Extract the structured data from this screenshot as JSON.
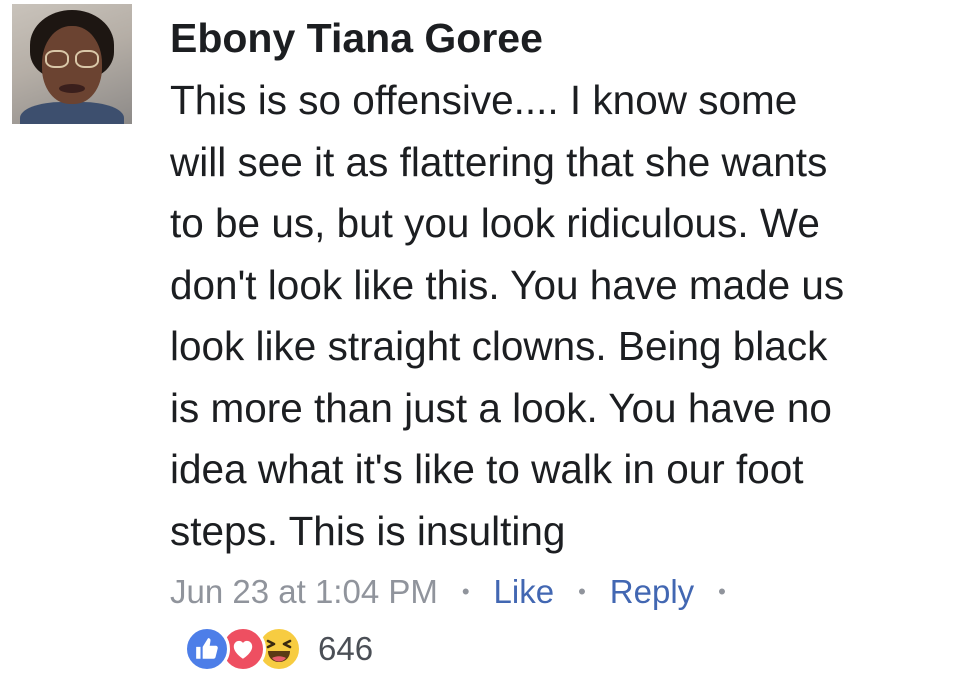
{
  "comment": {
    "author": "Ebony Tiana Goree",
    "text_lines": [
      "This is so offensive.... I know some",
      "will see it as flattering that she wants",
      "to be us, but you look ridiculous. We",
      "don't look like this. You have made us",
      "look like straight clowns. Being black",
      "is more than just a look. You have no",
      "idea what it's like to walk in our foot",
      "steps. This is insulting"
    ],
    "timestamp": "Jun 23 at 1:04 PM",
    "separator": "•",
    "like_label": "Like",
    "reply_label": "Reply",
    "reactions": {
      "icons": [
        "like-icon",
        "love-icon",
        "haha-icon"
      ],
      "count": "646"
    }
  },
  "colors": {
    "link": "#4267b2",
    "muted": "#90949c",
    "text": "#1c1e21",
    "like": "#4d7ee8",
    "love": "#ee4f61",
    "haha": "#f7cc41"
  }
}
